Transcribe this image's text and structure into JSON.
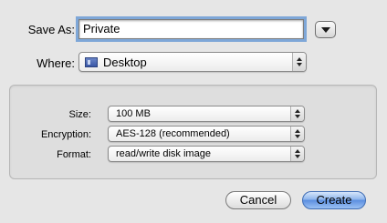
{
  "save_as": {
    "label": "Save As:",
    "value": "Private"
  },
  "where": {
    "label": "Where:",
    "selected": "Desktop",
    "icon": "desktop-folder-icon"
  },
  "options": {
    "size": {
      "label": "Size:",
      "selected": "100 MB"
    },
    "encryption": {
      "label": "Encryption:",
      "selected": "AES-128 (recommended)"
    },
    "format": {
      "label": "Format:",
      "selected": "read/write disk image"
    }
  },
  "buttons": {
    "cancel": "Cancel",
    "create": "Create"
  },
  "colors": {
    "focus_ring": "#7ea7d8",
    "default_button": "#5b8ee0"
  }
}
